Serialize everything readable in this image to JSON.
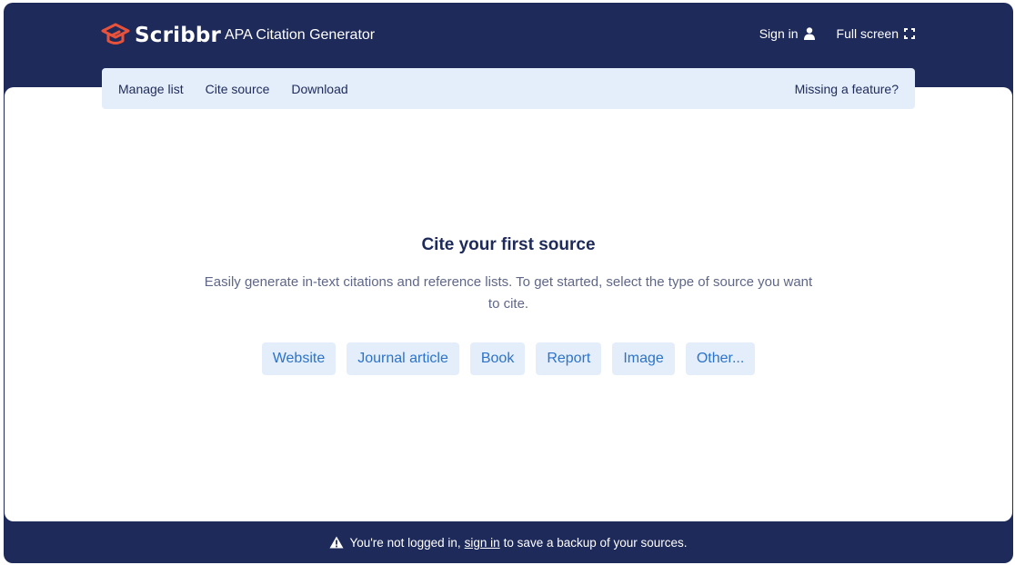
{
  "brand": {
    "name": "Scribbr",
    "app_title": "APA Citation Generator",
    "colors": {
      "navy": "#1e2a5a",
      "accent": "#e8523a",
      "link": "#2c73c9",
      "chip_bg": "#e4eefa"
    }
  },
  "header": {
    "sign_in_label": "Sign in",
    "sign_in_icon": "user-icon",
    "full_screen_label": "Full screen",
    "full_screen_icon": "expand-icon"
  },
  "subnav": {
    "items": [
      "Manage list",
      "Cite source",
      "Download"
    ],
    "feedback_label": "Missing a feature?"
  },
  "empty_state": {
    "title": "Cite your first source",
    "description": "Easily generate in-text citations and reference lists. To get started, select the type of source you want to cite.",
    "source_types": [
      "Website",
      "Journal article",
      "Book",
      "Report",
      "Image",
      "Other..."
    ]
  },
  "footer": {
    "icon": "warning-icon",
    "before_link": "You're not logged in,",
    "link": "sign in",
    "after_link": "to save a backup of your sources."
  }
}
